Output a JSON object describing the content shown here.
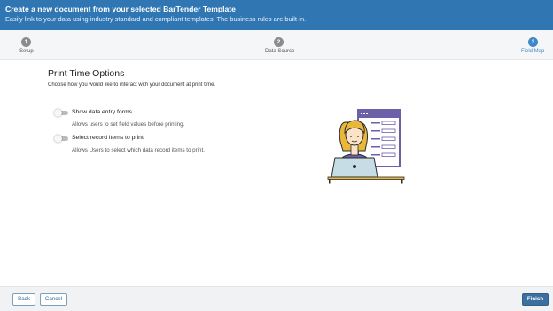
{
  "header": {
    "title": "Create a new document from your selected BarTender Template",
    "subtitle": "Easily link to your data using industry standard and compliant templates. The business rules are built-in."
  },
  "steps": [
    {
      "number": "1",
      "label": "Setup",
      "state": "done"
    },
    {
      "number": "2",
      "label": "Data Source",
      "state": "done"
    },
    {
      "number": "3",
      "label": "Field Map",
      "state": "active"
    }
  ],
  "content": {
    "title": "Print Time Options",
    "description": "Choose how you would like to interact with your document at print time."
  },
  "options": [
    {
      "label": "Show data entry forms",
      "help": "Allows users to set field values before printing.",
      "enabled": false
    },
    {
      "label": "Select record items to print",
      "help": "Allows Users to select which data record items to print.",
      "enabled": false
    }
  ],
  "footer": {
    "back_label": "Back",
    "cancel_label": "Cancel",
    "finish_label": "Finish"
  },
  "colors": {
    "header_bg": "#2f76b3",
    "active_step": "#3d88c8",
    "primary_button": "#3a6f9f"
  }
}
